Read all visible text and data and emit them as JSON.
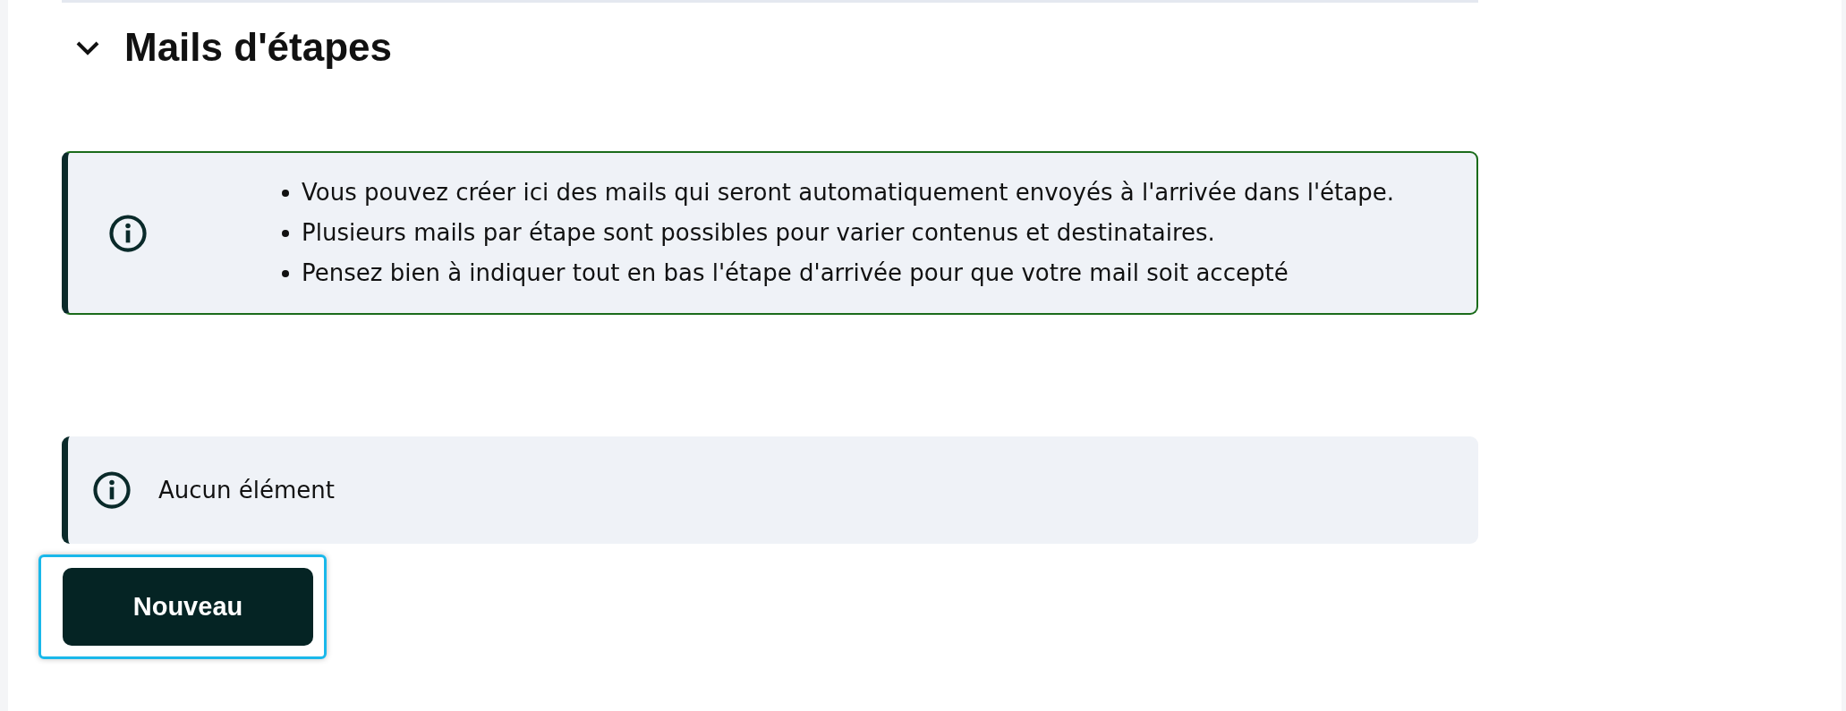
{
  "section": {
    "title": "Mails d'étapes",
    "expanded": true
  },
  "info_notice": {
    "items": [
      "Vous pouvez créer ici des mails qui seront automatiquement envoyés à l'arrivée dans l'étape.",
      "Plusieurs mails par étape sont possibles pour varier contenus et destinataires.",
      "Pensez bien à indiquer tout en bas l'étape d'arrivée pour que votre mail soit accepté"
    ]
  },
  "empty_notice": {
    "text": "Aucun élément"
  },
  "new_button": {
    "label": "Nouveau",
    "focused": true
  }
}
